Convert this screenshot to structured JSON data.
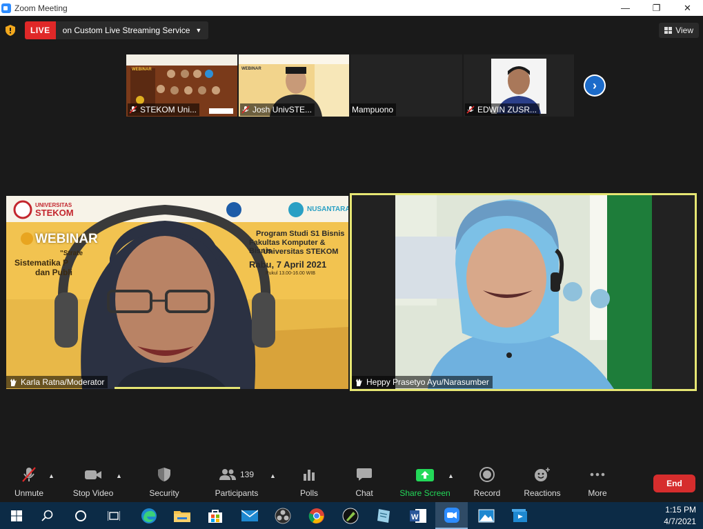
{
  "window": {
    "title": "Zoom Meeting",
    "controls": [
      "—",
      "❐",
      "✕"
    ]
  },
  "topbar": {
    "live_label": "LIVE",
    "live_service": "on Custom Live Streaming Service",
    "view_label": "View"
  },
  "thumbnails": [
    {
      "name": "STEKOM Uni...",
      "muted": true
    },
    {
      "name": "Josh UnivSTE...",
      "muted": true
    },
    {
      "name": "Mampuono",
      "muted": false
    },
    {
      "name": "EDWIN ZUSR...",
      "muted": true
    }
  ],
  "webinar_banner": {
    "university": "UNIVERSITAS",
    "university_name": "STEKOM",
    "webinar": "WEBINAR",
    "topic_line1": "\"Strate",
    "topic_line2": "Sistematika P",
    "topic_line3": "dan Publi",
    "program_line1": "Program Studi S1 Bisnis",
    "program_line2": "Fakultas Komputer & Bisnis",
    "program_line3": "Universitas STEKOM",
    "date": "Rabu, 7 April 2021",
    "time": "Pukul 13.00-16.00 WIB",
    "partner": "NUSANTARA"
  },
  "main_tiles": [
    {
      "name": "Karla Ratna/Moderator"
    },
    {
      "name": "Heppy Prasetyo Ayu/Narasumber"
    }
  ],
  "toolbar": {
    "unmute": "Unmute",
    "stop_video": "Stop Video",
    "security": "Security",
    "participants": "Participants",
    "participants_count": "139",
    "polls": "Polls",
    "chat": "Chat",
    "share_screen": "Share Screen",
    "record": "Record",
    "reactions": "Reactions",
    "more": "More",
    "end": "End"
  },
  "taskbar": {
    "time": "1:15 PM",
    "date": "4/7/2021"
  },
  "colors": {
    "live_red": "#E02828",
    "share_green": "#23D959",
    "end_red": "#D62D2D",
    "active_speaker": "#E6E673",
    "taskbar": "#0c2b46"
  }
}
